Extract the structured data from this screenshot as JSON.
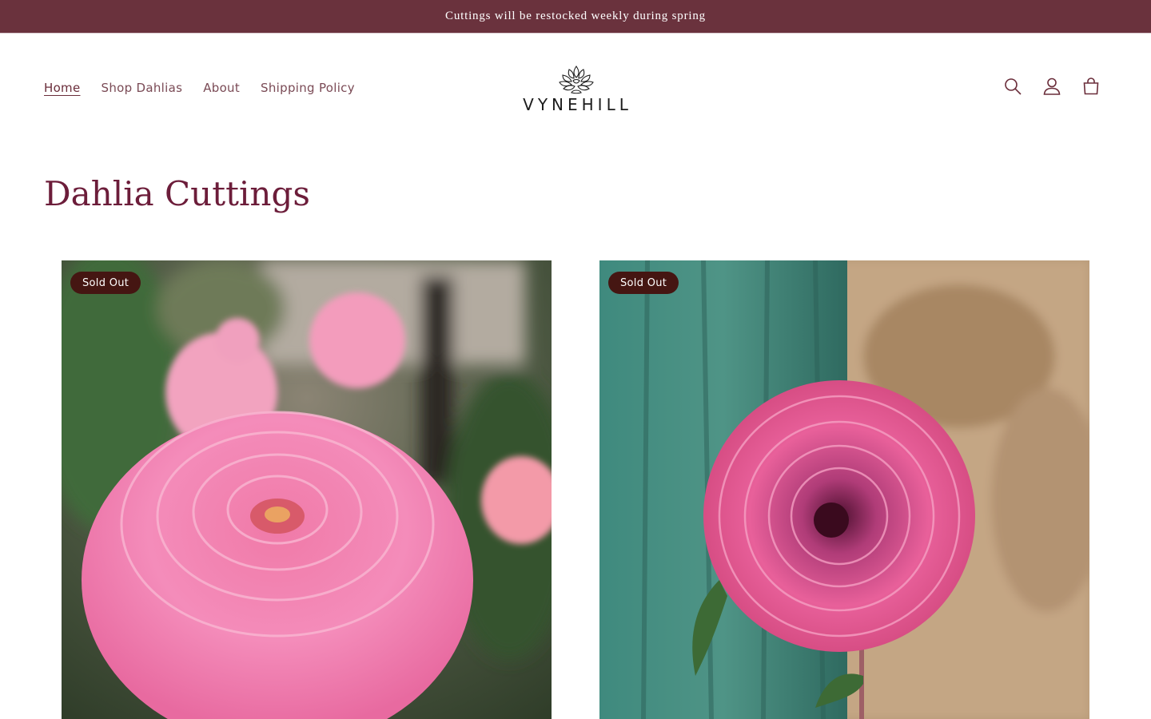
{
  "announcement": {
    "text": "Cuttings will be restocked weekly during spring"
  },
  "nav": {
    "items": [
      {
        "label": "Home",
        "active": true
      },
      {
        "label": "Shop Dahlias",
        "active": false
      },
      {
        "label": "About",
        "active": false
      },
      {
        "label": "Shipping Policy",
        "active": false
      }
    ]
  },
  "logo": {
    "text": "VYNEHILL",
    "icon": "dahlia-logo-icon"
  },
  "header_icons": [
    "search-icon",
    "account-icon",
    "cart-icon"
  ],
  "page": {
    "title": "Dahlia Cuttings"
  },
  "products": [
    {
      "badge": "Sold Out",
      "image": "pink-ball-dahlia-photo"
    },
    {
      "badge": "Sold Out",
      "image": "magenta-dahlia-photo"
    }
  ],
  "colors": {
    "announcement_bg": "#6a323d",
    "title": "#6c1d3a",
    "badge_bg": "#451612",
    "nav_text": "#7a4a55"
  }
}
